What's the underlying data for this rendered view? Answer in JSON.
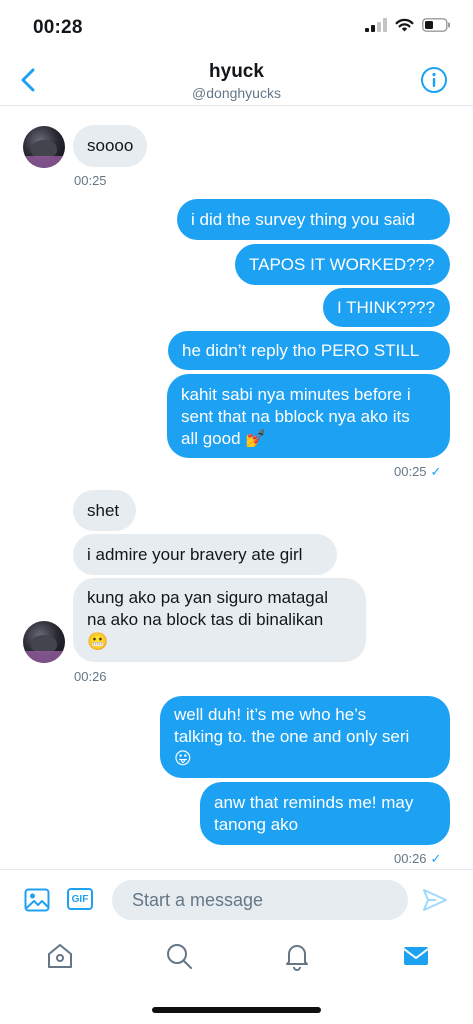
{
  "status": {
    "time": "00:28"
  },
  "header": {
    "title": "hyuck",
    "handle": "@donghyucks"
  },
  "messages": [
    {
      "text": "soooo"
    },
    {
      "text": "i did the survey thing you said"
    },
    {
      "text": "TAPOS IT WORKED???"
    },
    {
      "text": "I THINK????"
    },
    {
      "text": "he didn’t reply tho PERO STILL"
    },
    {
      "text": "kahit sabi nya minutes before i\nsent that na bblock nya ako its\nall good 💅"
    },
    {
      "text": "shet"
    },
    {
      "text": "i admire your bravery ate girl"
    },
    {
      "text": "kung ako pa yan siguro matagal\nna ako na block tas di binalikan\n😬"
    },
    {
      "text": "well duh! it’s me who he’s\ntalking to. the one and only seri\n😛"
    },
    {
      "text": "anw that reminds me! may\ntanong ako"
    }
  ],
  "timestamps": {
    "t1": "00:25",
    "t2": "00:25",
    "t3": "00:26",
    "t4": "00:26"
  },
  "composer": {
    "placeholder": "Start a message",
    "gif_label": "GIF"
  },
  "colors": {
    "accent": "#1da1f2",
    "incoming_bubble": "#e6ecf0",
    "secondary_text": "#657786"
  },
  "icons": [
    "back-icon",
    "info-icon",
    "image-icon",
    "gif-icon",
    "send-icon",
    "home-icon",
    "search-icon",
    "bell-icon",
    "mail-icon"
  ]
}
